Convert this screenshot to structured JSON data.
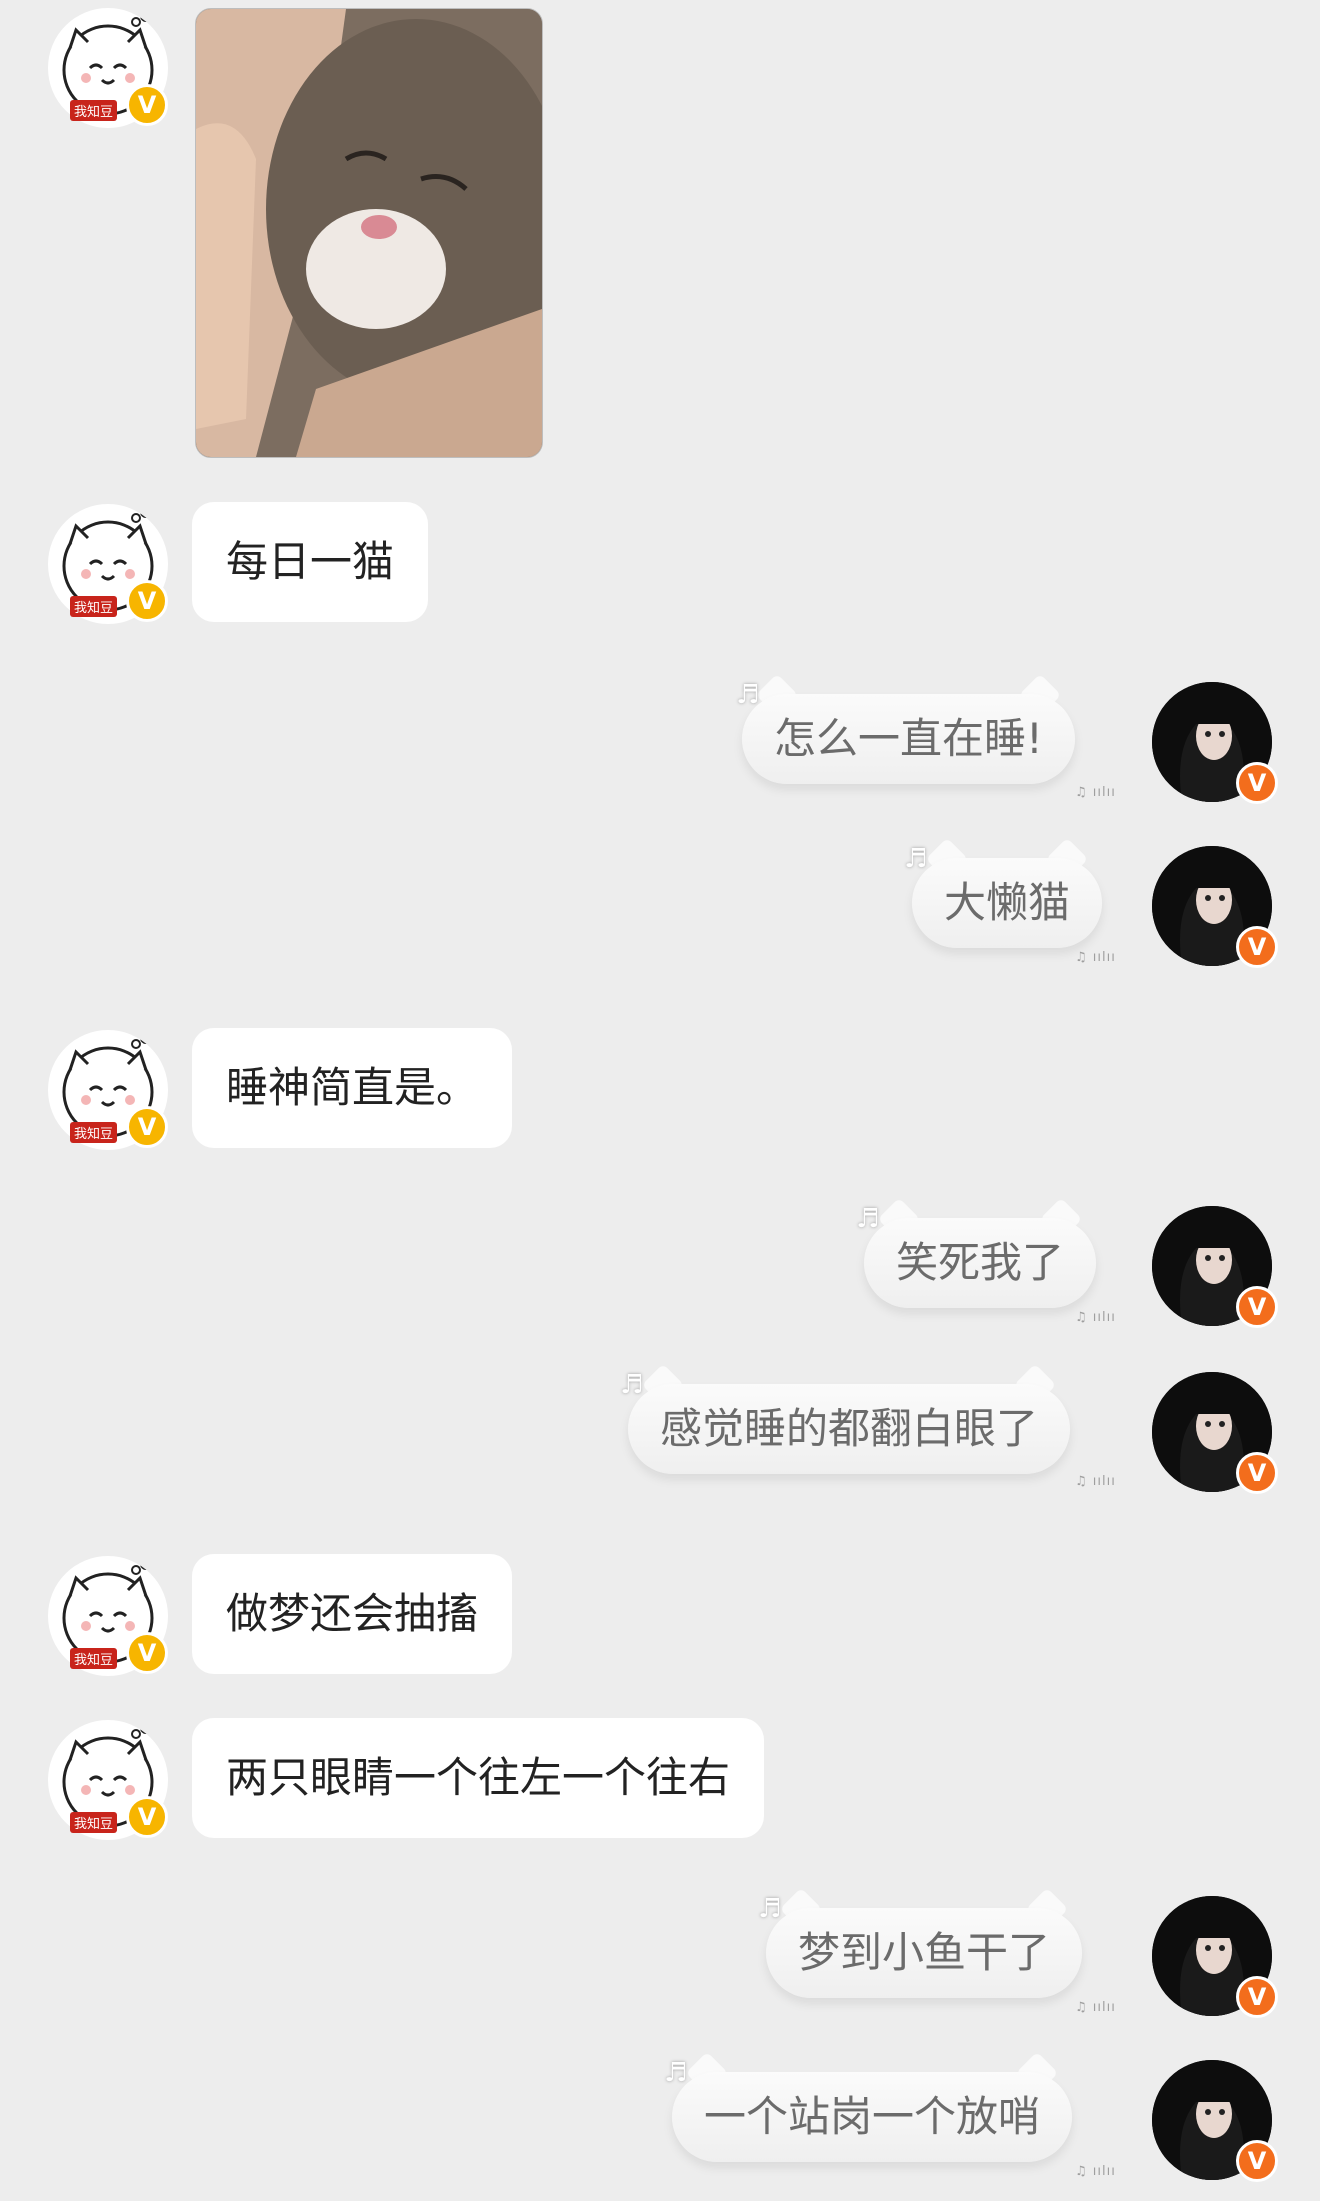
{
  "colors": {
    "background": "#ededed",
    "left_badge": "#f7b500",
    "right_badge": "#f36d1c",
    "tag": "#c8241b"
  },
  "left_user": {
    "tag": "我知豆",
    "badge": "V"
  },
  "right_user": {
    "badge": "V"
  },
  "messages": {
    "m1": "每日一猫",
    "m2": "怎么一直在睡!",
    "m3": "大懒猫",
    "m4": "睡神简直是。",
    "m5": "笑死我了",
    "m6": "感觉睡的都翻白眼了",
    "m7": "做梦还会抽搐",
    "m8": "两只眼睛一个往左一个往右",
    "m9": "梦到小鱼干了",
    "m10": "一个站岗一个放哨"
  }
}
